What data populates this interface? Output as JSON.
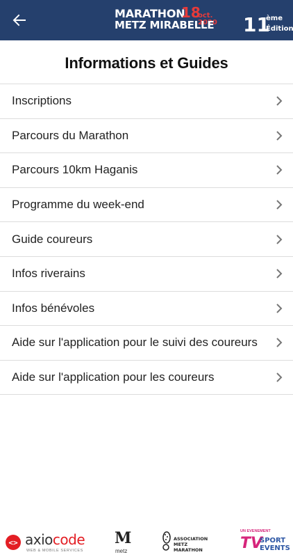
{
  "appbar": {
    "brand_line1": "MARATHON",
    "brand_line2": "METZ MIRABELLE",
    "brand_day": "18",
    "brand_date": "oct. 2020",
    "edition_number": "11",
    "edition_suffix": "ème",
    "edition_label": "Édition",
    "background_color": "#25406d",
    "accent_color": "#e63a3a",
    "back_icon": "arrow-left-icon"
  },
  "page": {
    "title": "Informations et Guides"
  },
  "menu": {
    "items": [
      {
        "label": "Inscriptions"
      },
      {
        "label": "Parcours du Marathon"
      },
      {
        "label": "Parcours 10km Haganis"
      },
      {
        "label": "Programme du week-end"
      },
      {
        "label": "Guide coureurs"
      },
      {
        "label": "Infos riverains"
      },
      {
        "label": "Infos bénévoles"
      },
      {
        "label": "Aide sur l'application pour le suivi des coureurs"
      },
      {
        "label": "Aide sur l'application pour les coureurs"
      }
    ],
    "chevron_icon": "chevron-right-icon"
  },
  "sponsors": {
    "axiocode_name_a": "axio",
    "axiocode_name_b": "code",
    "axiocode_tagline": "WEB & MOBILE SERVICES",
    "metz_label": "metz",
    "asso_line1": "ASSOCIATION",
    "asso_line2": "METZ MARATHON",
    "tv_top": "UN EVENEMENT",
    "tv_logo": "TV",
    "tv_line1": "SPORT",
    "tv_line2": "EVENTS"
  }
}
